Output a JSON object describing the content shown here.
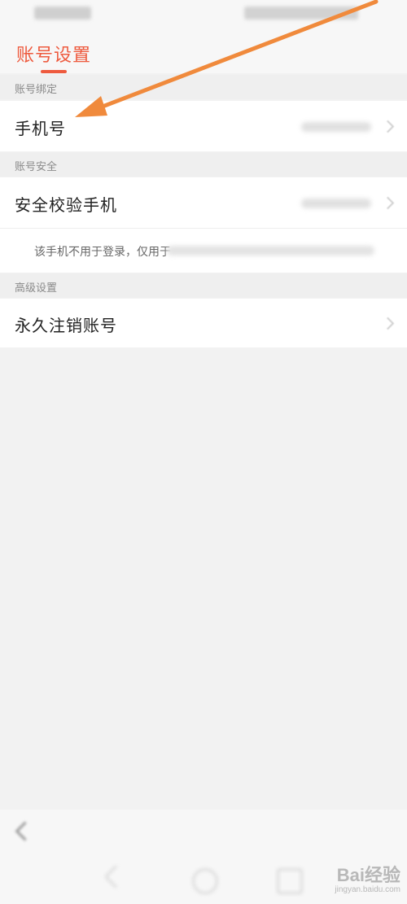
{
  "header": {
    "title": "账号设置"
  },
  "sections": [
    {
      "header": "账号绑定",
      "rows": [
        {
          "label": "手机号"
        }
      ]
    },
    {
      "header": "账号安全",
      "rows": [
        {
          "label": "安全校验手机"
        }
      ],
      "note": "该手机不用于登录，仅用于"
    },
    {
      "header": "高级设置",
      "rows": [
        {
          "label": "永久注销账号"
        }
      ]
    }
  ],
  "annotation": {
    "arrow_color": "#f08a3c"
  },
  "watermark": {
    "brand": "Bai经验",
    "url": "jingyan.baidu.com"
  },
  "colors": {
    "accent": "#ee5a3e",
    "background": "#f2f2f2"
  }
}
